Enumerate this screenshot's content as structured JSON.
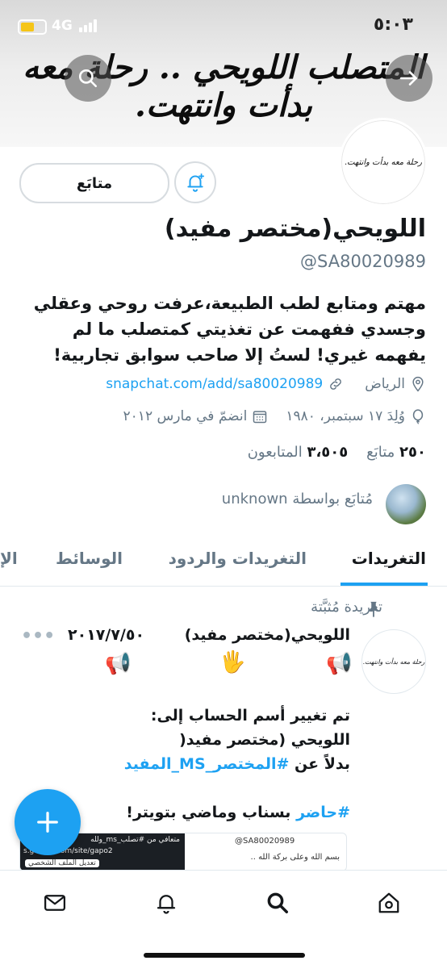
{
  "status": {
    "time": "٥:٠٣",
    "network": "4G"
  },
  "banner": {
    "text": "المتصلب اللويحي .. رحلة معه بدأت وانتهت."
  },
  "avatar": {
    "text": "رحلة معه بدأت وانتهت."
  },
  "profile": {
    "follow_label": "متابَع",
    "name": "اللويحي(مختصر مفيد)",
    "handle": "@SA80020989",
    "bio_lines": [
      "مهتم ومتابع لطب الطبيعة،عرفت روحي وعقلي",
      "وجسدي ففهمت عن تغذيتي كمتصلب ما لم",
      "يفهمه غيري! لستُ إلا صاحب سوابق تجاربية!"
    ],
    "location": "الرياض",
    "link": "snapchat.com/add/sa80020989",
    "born": "وُلِدَ ١٧ سبتمبر، ١٩٨٠",
    "joined": "انضمّ في مارس ٢٠١٢",
    "following_count": "٢٥٠",
    "following_label": "متابَع",
    "followers_count": "٣،٥٠٥",
    "followers_label": "المتابعون",
    "followed_by": "مُتابَع بواسطة unknown"
  },
  "tabs": [
    "التغريدات",
    "التغريدات والردود",
    "الوسائط",
    "الإ"
  ],
  "tweet": {
    "pinned_label": "تغريدة مُثبَّتة",
    "author": "اللويحي(مختصر مفيد)",
    "date": "٢٠١٧/٧/٥٠",
    "emojis": [
      "📢",
      "🖐",
      "📢"
    ],
    "line1": "تم تغيير أسم الحساب إلى:",
    "line2": "اللويحي (مختصر مفيد(",
    "line3_prefix": "بدلاً عن",
    "line3_tag": "#المختصر_MS_المفيد",
    "line4_tag": "#حاضر",
    "line4_rest": "بسناب وماضي بتويتر!",
    "card_handle": "@SA80020989",
    "card_text": "بسم الله وعلى بركة الله ..",
    "card_dark_1": "متعافي من #تصلب_ms_ولله",
    "card_dark_2": "s.google.com/site/gapo2",
    "card_dark_3": "تعديل الملف الشخصي"
  }
}
